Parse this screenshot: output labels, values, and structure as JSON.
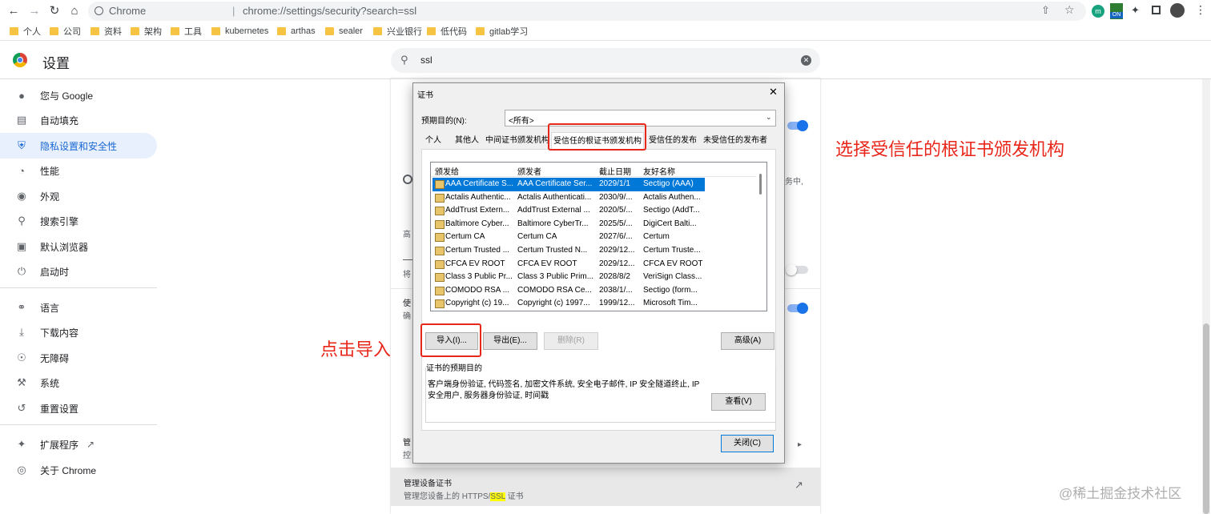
{
  "browser": {
    "omnibox_site": "Chrome",
    "omnibox_url": "chrome://settings/security?search=ssl",
    "bookmarks": [
      "个人",
      "公司",
      "资料",
      "架构",
      "工具",
      "kubernetes",
      "arthas",
      "sealer",
      "兴业银行",
      "低代码",
      "gitlab学习"
    ],
    "ext_badge": "ON"
  },
  "settings": {
    "title": "设置",
    "search_value": "ssl",
    "sidebar": [
      {
        "icon": "person-icon",
        "label": "您与 Google"
      },
      {
        "icon": "clipboard-icon",
        "label": "自动填充"
      },
      {
        "icon": "shield-icon",
        "label": "隐私设置和安全性"
      },
      {
        "icon": "gauge-icon",
        "label": "性能"
      },
      {
        "icon": "palette-icon",
        "label": "外观"
      },
      {
        "icon": "search-icon",
        "label": "搜索引擎"
      },
      {
        "icon": "browser-icon",
        "label": "默认浏览器"
      },
      {
        "icon": "power-icon",
        "label": "启动时"
      },
      {
        "icon": "globe-icon",
        "label": "语言"
      },
      {
        "icon": "download-icon",
        "label": "下载内容"
      },
      {
        "icon": "accessibility-icon",
        "label": "无障碍"
      },
      {
        "icon": "wrench-icon",
        "label": "系统"
      },
      {
        "icon": "restore-icon",
        "label": "重置设置"
      },
      {
        "icon": "puzzle-icon",
        "label": "扩展程序"
      },
      {
        "icon": "chrome-icon",
        "label": "关于 Chrome"
      }
    ],
    "card_fragments": [
      "高",
      "将",
      "使",
      "确",
      "管",
      "控",
      "务中,"
    ],
    "manage_certs_title": "管理设备证书",
    "manage_certs_desc_pre": "管理您设备上的 HTTPS/",
    "manage_certs_desc_hl": "SSL",
    "manage_certs_desc_post": " 证书"
  },
  "dialog": {
    "title": "证书",
    "purpose_label": "预期目的(N):",
    "purpose_value": "<所有>",
    "tabs": [
      "个人",
      "其他人",
      "中间证书颁发机构",
      "受信任的根证书颁发机构",
      "受信任的发布者",
      "未受信任的发布者"
    ],
    "columns": [
      "颁发给",
      "颁发者",
      "截止日期",
      "友好名称"
    ],
    "rows": [
      [
        "AAA Certificate S...",
        "AAA Certificate Ser...",
        "2029/1/1",
        "Sectigo (AAA)"
      ],
      [
        "Actalis Authentic...",
        "Actalis Authenticati...",
        "2030/9/...",
        "Actalis Authen..."
      ],
      [
        "AddTrust Extern...",
        "AddTrust External ...",
        "2020/5/...",
        "Sectigo (AddT..."
      ],
      [
        "Baltimore Cyber...",
        "Baltimore CyberTr...",
        "2025/5/...",
        "DigiCert Balti..."
      ],
      [
        "Certum CA",
        "Certum CA",
        "2027/6/...",
        "Certum"
      ],
      [
        "Certum Trusted ...",
        "Certum Trusted N...",
        "2029/12...",
        "Certum Truste..."
      ],
      [
        "CFCA EV ROOT",
        "CFCA EV ROOT",
        "2029/12...",
        "CFCA EV ROOT"
      ],
      [
        "Class 3 Public Pr...",
        "Class 3 Public Prim...",
        "2028/8/2",
        "VeriSign Class..."
      ],
      [
        "COMODO RSA ...",
        "COMODO RSA Ce...",
        "2038/1/...",
        "Sectigo (form..."
      ],
      [
        "Copyright (c) 19...",
        "Copyright (c) 1997...",
        "1999/12...",
        "Microsoft Tim..."
      ]
    ],
    "btn_import": "导入(I)...",
    "btn_export": "导出(E)...",
    "btn_remove": "删除(R)",
    "btn_advanced": "高级(A)",
    "purposes_group": "证书的预期目的",
    "purposes_text": "客户端身份验证, 代码签名, 加密文件系统, 安全电子邮件, IP 安全隧道终止, IP 安全用户, 服务器身份验证, 时间戳",
    "btn_view": "查看(V)",
    "btn_close": "关闭(C)"
  },
  "annotations": {
    "choose_root": "选择受信任的根证书颁发机构",
    "click_import": "点击导入",
    "watermark": "@稀土掘金技术社区"
  }
}
